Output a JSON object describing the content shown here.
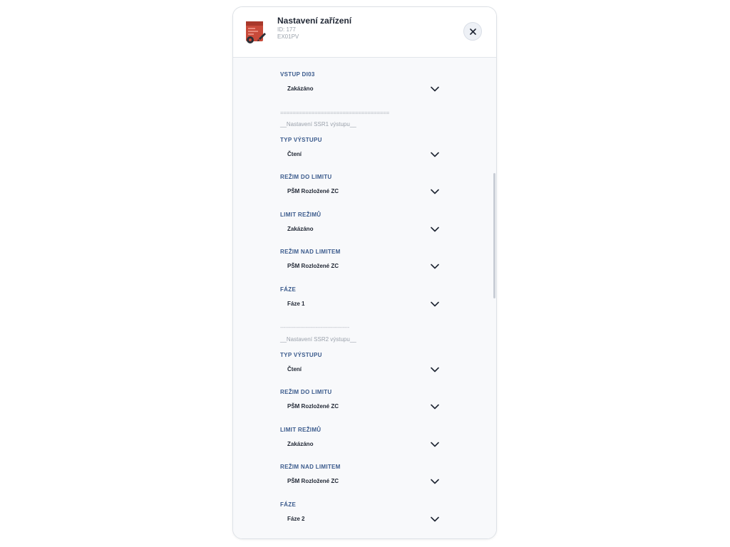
{
  "header": {
    "title": "Nastavení zařízení",
    "device_id": "ID: 177",
    "device_model": "EX01PV",
    "close_symbol": "✕"
  },
  "colors": {
    "label": "#3a5a8c",
    "value": "#1f2633",
    "muted": "#9aa1ab",
    "background": "#f8f9fb",
    "device_red": "#c84a3a"
  },
  "icons": {
    "device": "device-image-icon",
    "close": "close-icon",
    "chevron": "chevron-down-icon"
  },
  "form": {
    "di03": {
      "label": "VSTUP DI03",
      "value": "Zakázáno"
    },
    "sep1": "===================================",
    "ssr1_title": "__Nastavení SSR1 výstupu__",
    "ssr1": {
      "output_type": {
        "label": "TYP VÝSTUPU",
        "value": "Čtení"
      },
      "mode_below": {
        "label": "REŽIM DO LIMITU",
        "value": "PŠM Rozložené ZC"
      },
      "limit": {
        "label": "LIMIT REŽIMŮ",
        "value": "Zakázáno"
      },
      "mode_above": {
        "label": "REŽIM NAD LIMITEM",
        "value": "PŠM Rozložené ZC"
      },
      "phase": {
        "label": "FÁZE",
        "value": "Fáze 1"
      }
    },
    "sep2": "-----------------------------------------",
    "ssr2_title": "__Nastavení SSR2 výstupu__",
    "ssr2": {
      "output_type": {
        "label": "TYP VÝSTUPU",
        "value": "Čtení"
      },
      "mode_below": {
        "label": "REŽIM DO LIMITU",
        "value": "PŠM Rozložené ZC"
      },
      "limit": {
        "label": "LIMIT REŽIMŮ",
        "value": "Zakázáno"
      },
      "mode_above": {
        "label": "REŽIM NAD LIMITEM",
        "value": "PŠM Rozložené ZC"
      },
      "phase": {
        "label": "FÁZE",
        "value": "Fáze 2"
      }
    },
    "sep3": "-----------------------------------------"
  }
}
